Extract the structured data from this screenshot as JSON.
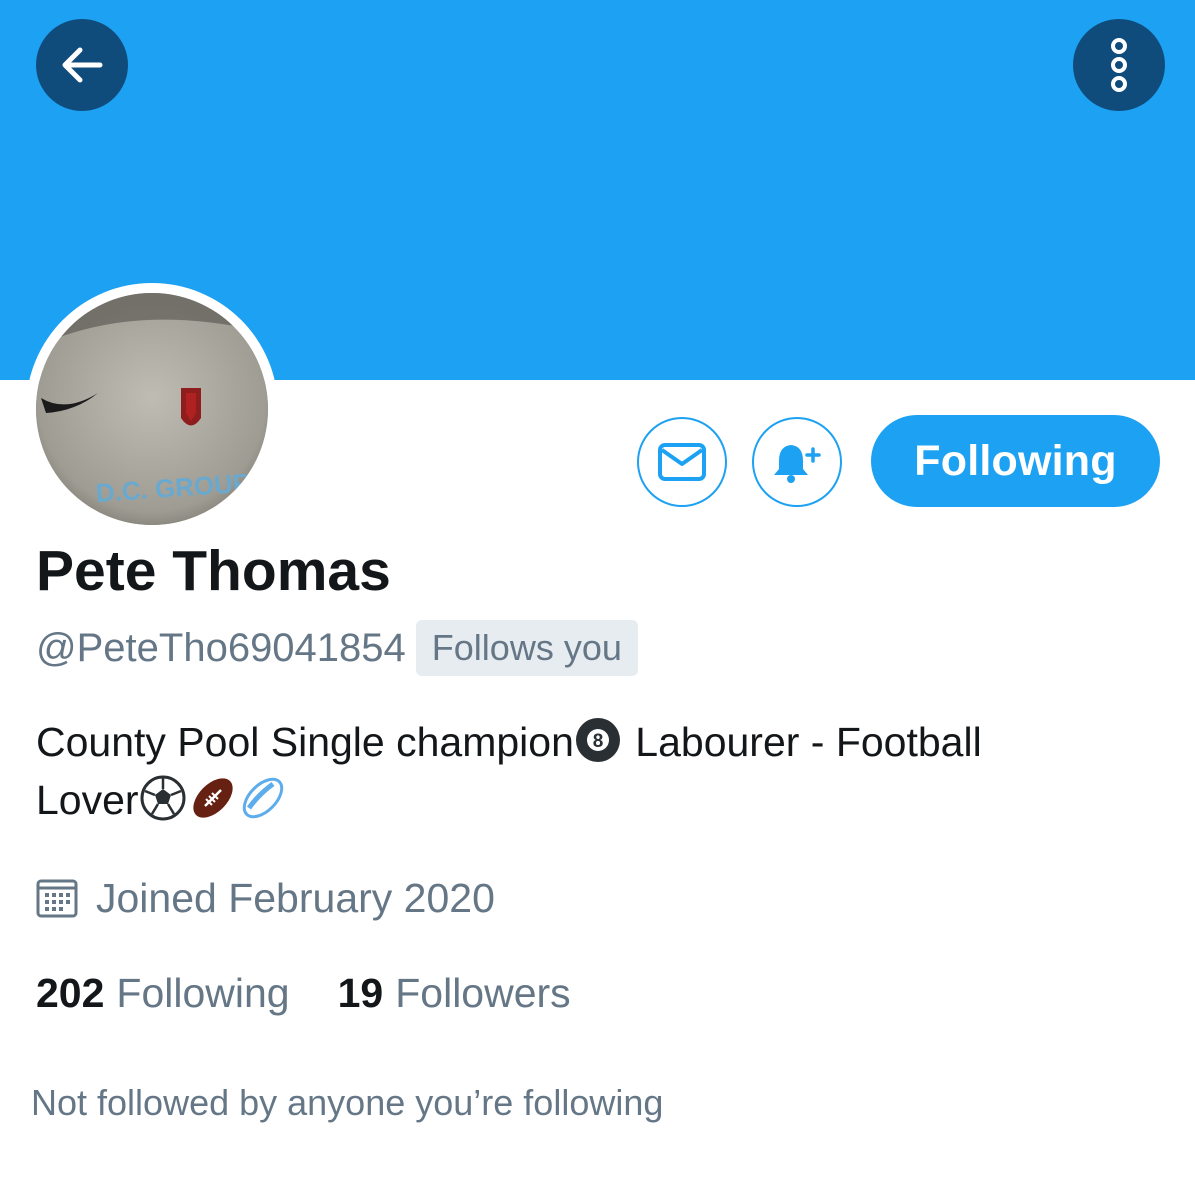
{
  "colors": {
    "banner": "#1da1f2",
    "accent": "#1da1f2",
    "header_button_bg": "#0f4c7c",
    "text_primary": "#14171a",
    "text_secondary": "#657786",
    "badge_bg": "#e6ecf0"
  },
  "header": {
    "back_icon": "arrow-left-icon",
    "more_icon": "vertical-ellipsis-icon"
  },
  "actions": {
    "message_icon": "envelope-icon",
    "notify_icon": "bell-plus-icon",
    "follow_button_label": "Following"
  },
  "profile": {
    "avatar_text": "D.C. GROUP",
    "name": "Pete Thomas",
    "handle": "@PeteTho69041854",
    "follows_you_badge": "Follows you",
    "bio_line1": "County Pool Single champion",
    "bio_line1_emoji": "pool-8-ball-emoji",
    "bio_line1_rest": " Labourer - Football",
    "bio_line2": "Lover",
    "bio_emojis": [
      "soccer-ball-emoji",
      "american-football-emoji",
      "rugby-ball-emoji"
    ],
    "joined_icon": "calendar-icon",
    "joined": "Joined February 2020",
    "following_count": "202",
    "following_label": "Following",
    "followers_count": "19",
    "followers_label": "Followers",
    "mutual_followers": "Not followed by anyone you’re following"
  }
}
